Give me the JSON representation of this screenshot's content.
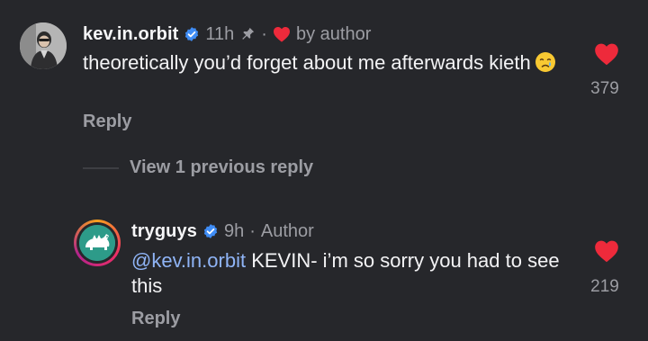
{
  "colors": {
    "background": "#26272b",
    "text": "#f3f3f5",
    "muted": "#9c9da3",
    "verified": "#3f8df6",
    "heart": "#ee2a3b",
    "mention": "#8fb4f6"
  },
  "comment": {
    "username": "kev.in.orbit",
    "time": "11h",
    "pin_icon": "pin-icon",
    "separator": "·",
    "liked_by_author_label": "by author",
    "text": "theoretically you’d forget about me afterwards kieth",
    "emoji": "crying-face",
    "reply_label": "Reply",
    "like_count": "379"
  },
  "thread": {
    "view_previous_label": "View 1 previous reply"
  },
  "reply": {
    "username": "tryguys",
    "time": "9h",
    "separator": "·",
    "author_label": "Author",
    "mention": "@kev.in.orbit",
    "text": " KEVIN- i’m so sorry you had to see this",
    "reply_label": "Reply",
    "like_count": "219"
  }
}
